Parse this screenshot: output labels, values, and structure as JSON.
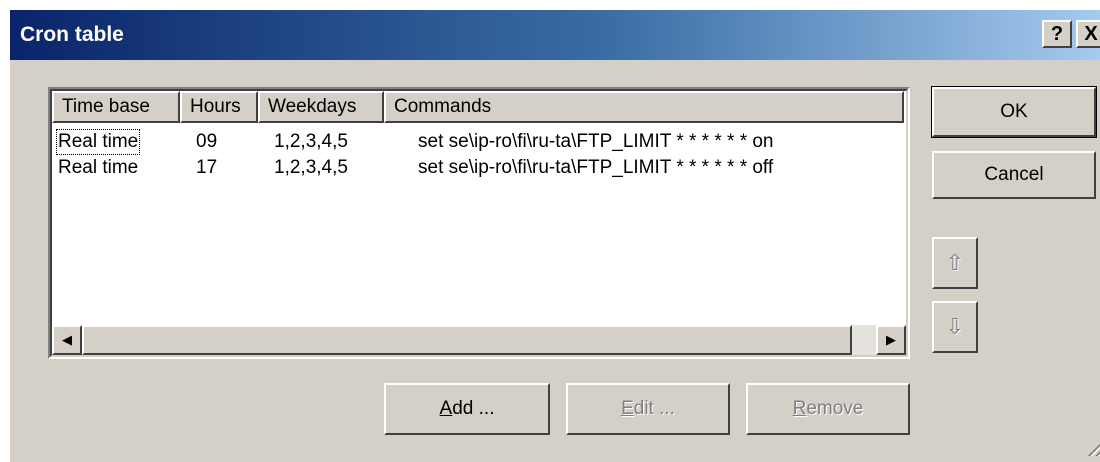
{
  "window": {
    "title": "Cron table",
    "help_glyph": "?",
    "close_glyph": "X"
  },
  "table": {
    "columns": [
      "Time base",
      "Hours",
      "Weekdays",
      "Commands"
    ],
    "rows": [
      {
        "time_base": "Real time",
        "hours": "09",
        "weekdays": "1,2,3,4,5",
        "command": "set se\\ip-ro\\fi\\ru-ta\\FTP_LIMIT * * * * * * on"
      },
      {
        "time_base": "Real time",
        "hours": "17",
        "weekdays": "1,2,3,4,5",
        "command": "set se\\ip-ro\\fi\\ru-ta\\FTP_LIMIT * * * * * * off"
      }
    ],
    "scroll_left_glyph": "◀",
    "scroll_right_glyph": "▶"
  },
  "buttons": {
    "ok": "OK",
    "cancel": "Cancel",
    "move_up_glyph": "⇧",
    "move_down_glyph": "⇩",
    "add_mnemonic": "A",
    "add_rest": "dd ...",
    "edit_mnemonic": "E",
    "edit_rest": "dit ...",
    "remove_mnemonic": "R",
    "remove_rest": "emove"
  }
}
